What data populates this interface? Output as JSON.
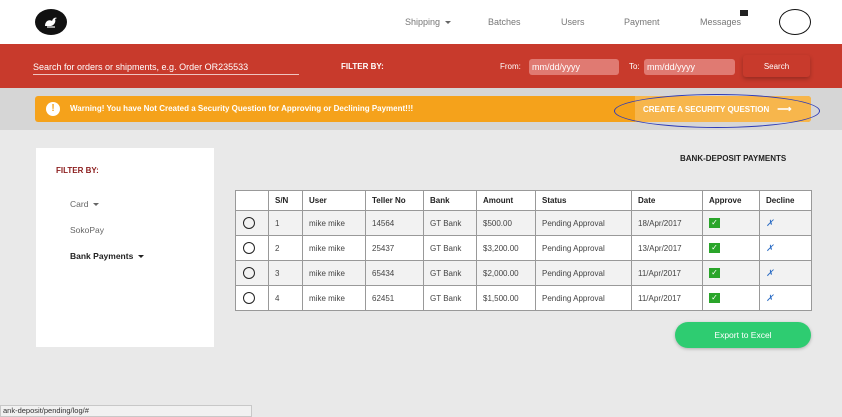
{
  "nav": {
    "items": [
      {
        "label": "Shipping",
        "has_caret": true
      },
      {
        "label": "Batches"
      },
      {
        "label": "Users"
      },
      {
        "label": "Payment"
      },
      {
        "label": "Messages"
      }
    ]
  },
  "filterbar": {
    "search_placeholder": "Search for orders or shipments, e.g. Order OR235533",
    "filter_label": "FILTER BY:",
    "from_label": "From:",
    "from_placeholder": "mm/dd/yyyy",
    "to_label": "To:",
    "to_placeholder": "mm/dd/yyyy",
    "search_button": "Search"
  },
  "warning": {
    "icon": "!",
    "text": "Warning! You have Not Created a Security Question for Approving or Declining Payment!!!",
    "button": "CREATE A SECURITY QUESTION",
    "arrow": "⟶"
  },
  "sidebar": {
    "title": "FILTER BY:",
    "items": [
      {
        "label": "Card"
      },
      {
        "label": "SokoPay"
      },
      {
        "label": "Bank Payments"
      }
    ]
  },
  "main": {
    "heading": "BANK-DEPOSIT PAYMENTS",
    "columns": [
      "",
      "S/N",
      "User",
      "Teller No",
      "Bank",
      "Amount",
      "Status",
      "Date",
      "Approve",
      "Decline"
    ],
    "rows": [
      {
        "sn": "1",
        "user": "mike mike",
        "teller": "14564",
        "bank": "GT Bank",
        "amount": "$500.00",
        "status": "Pending Approval",
        "date": "18/Apr/2017"
      },
      {
        "sn": "2",
        "user": "mike mike",
        "teller": "25437",
        "bank": "GT Bank",
        "amount": "$3,200.00",
        "status": "Pending Approval",
        "date": "13/Apr/2017"
      },
      {
        "sn": "3",
        "user": "mike mike",
        "teller": "65434",
        "bank": "GT Bank",
        "amount": "$2,000.00",
        "status": "Pending Approval",
        "date": "11/Apr/2017"
      },
      {
        "sn": "4",
        "user": "mike mike",
        "teller": "62451",
        "bank": "GT Bank",
        "amount": "$1,500.00",
        "status": "Pending Approval",
        "date": "11/Apr/2017"
      }
    ],
    "approve_glyph": "✓",
    "decline_glyph": "✗",
    "export_button": "Export to Excel"
  },
  "statusbar": {
    "url": "ank-deposit/pending/log/#"
  }
}
